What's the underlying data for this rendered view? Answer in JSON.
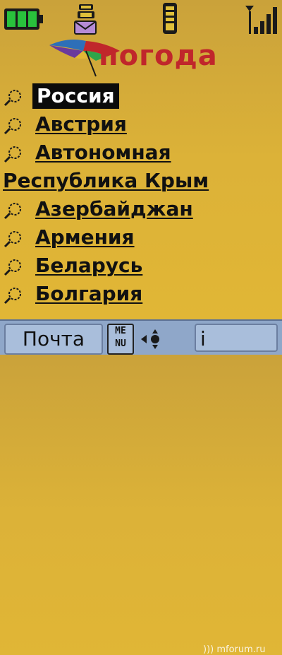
{
  "statusbar": {
    "icons": [
      "battery-icon",
      "message-icon",
      "phone-info-icon",
      "signal-icon"
    ]
  },
  "header": {
    "title": "погода",
    "logo": "umbrella-logo"
  },
  "list": {
    "items": [
      {
        "label": "Россия",
        "selected": true
      },
      {
        "label": "Австрия"
      },
      {
        "label": "Автономная"
      },
      {
        "label": "Республика Крым",
        "continuation": true
      },
      {
        "label": "Азербайджан"
      },
      {
        "label": "Армения"
      },
      {
        "label": "Беларусь"
      },
      {
        "label": "Болгария"
      }
    ]
  },
  "softkeys": {
    "left": "Почта",
    "menu_top": "ME",
    "menu_bottom": "NU",
    "right": "i"
  },
  "watermark": "mforum.ru",
  "colors": {
    "background": "#dcb238",
    "title": "#c0262b",
    "selection": "#0b0b0b",
    "softbar": "#8fa7c9"
  }
}
